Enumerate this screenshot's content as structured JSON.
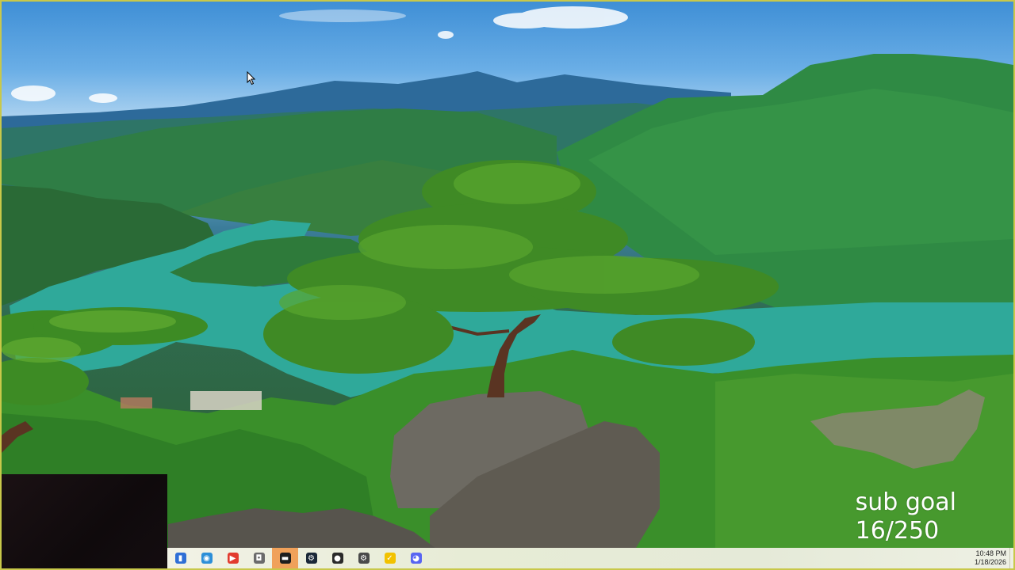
{
  "overlay": {
    "line1": "sub goal",
    "line2": "16/250"
  },
  "taskbar": {
    "icons": [
      {
        "name": "file-explorer-icon",
        "glyph": "▮",
        "color": "#2f6fd6"
      },
      {
        "name": "edge-browser-icon",
        "glyph": "◉",
        "color": "#2c8fd8"
      },
      {
        "name": "youtube-icon",
        "glyph": "▶",
        "color": "#e23b2e"
      },
      {
        "name": "screenshot-tool-icon",
        "glyph": "◘",
        "color": "#6b6b6b"
      },
      {
        "name": "obs-studio-icon",
        "glyph": "▬",
        "color": "#1e1e1e"
      },
      {
        "name": "steam-icon",
        "glyph": "⚙",
        "color": "#1b2838"
      },
      {
        "name": "davinci-resolve-icon",
        "glyph": "●",
        "color": "#2a2a2a"
      },
      {
        "name": "settings-icon",
        "glyph": "⚙",
        "color": "#4a4a4a"
      },
      {
        "name": "norton-icon",
        "glyph": "✓",
        "color": "#f2c200"
      },
      {
        "name": "discord-icon",
        "glyph": "◕",
        "color": "#5865f2"
      }
    ],
    "active_index": 4,
    "time": "10:48 PM",
    "date": "1/18/2026"
  }
}
